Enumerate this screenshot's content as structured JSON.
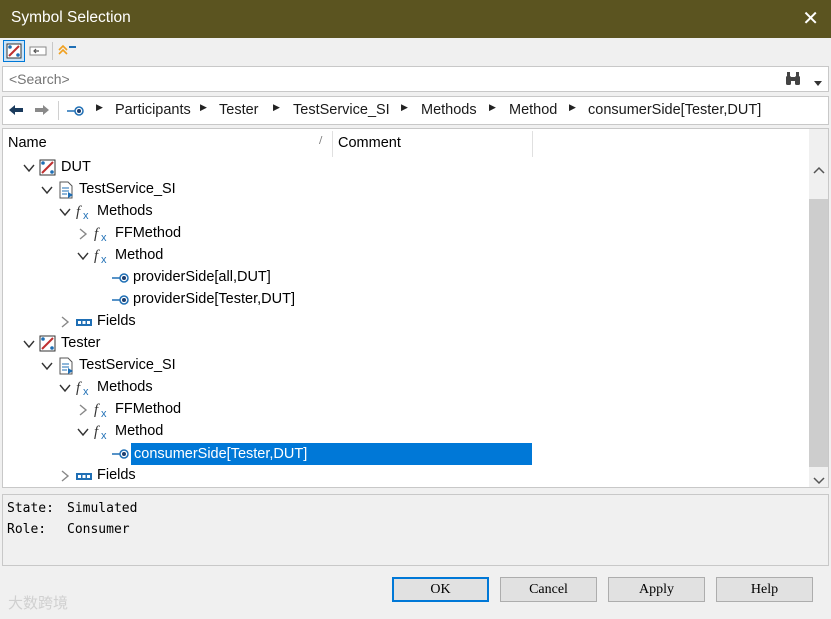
{
  "window": {
    "title": "Symbol Selection",
    "close_glyph": "✕"
  },
  "search": {
    "placeholder": "<Search>"
  },
  "breadcrumb": [
    "Participants",
    "Tester",
    "TestService_SI",
    "Methods",
    "Method",
    "consumerSide[Tester,DUT]"
  ],
  "tree": {
    "columns": {
      "name": "Name",
      "comment": "Comment"
    },
    "rows": [
      {
        "label": "DUT",
        "icon": "participant-icon",
        "expander": "expanded"
      },
      {
        "label": "TestService_SI",
        "icon": "service-interface-icon",
        "expander": "expanded"
      },
      {
        "label": "Methods",
        "icon": "function-icon",
        "expander": "expanded"
      },
      {
        "label": "FFMethod",
        "icon": "function-icon",
        "expander": "collapsed"
      },
      {
        "label": "Method",
        "icon": "function-icon",
        "expander": "expanded"
      },
      {
        "label": "providerSide[all,DUT]",
        "icon": "port-icon",
        "expander": "none"
      },
      {
        "label": "providerSide[Tester,DUT]",
        "icon": "port-icon",
        "expander": "none"
      },
      {
        "label": "Fields",
        "icon": "field-icon",
        "expander": "collapsed"
      },
      {
        "label": "Tester",
        "icon": "participant-icon",
        "expander": "expanded"
      },
      {
        "label": "TestService_SI",
        "icon": "service-interface-icon",
        "expander": "expanded"
      },
      {
        "label": "Methods",
        "icon": "function-icon",
        "expander": "expanded"
      },
      {
        "label": "FFMethod",
        "icon": "function-icon",
        "expander": "collapsed"
      },
      {
        "label": "Method",
        "icon": "function-icon",
        "expander": "expanded"
      },
      {
        "label": "consumerSide[Tester,DUT]",
        "icon": "port-icon",
        "expander": "none",
        "selected": true
      },
      {
        "label": "Fields",
        "icon": "field-icon",
        "expander": "collapsed"
      }
    ]
  },
  "info": {
    "state_label": "State:",
    "state_value": "Simulated",
    "role_label": "Role:",
    "role_value": "Consumer"
  },
  "buttons": {
    "ok": "OK",
    "cancel": "Cancel",
    "apply": "Apply",
    "help": "Help"
  },
  "watermark": "大数跨境",
  "colors": {
    "titlebar": "#5b5420",
    "selection": "#0078d7",
    "icon_blue": "#1f6fb5"
  }
}
